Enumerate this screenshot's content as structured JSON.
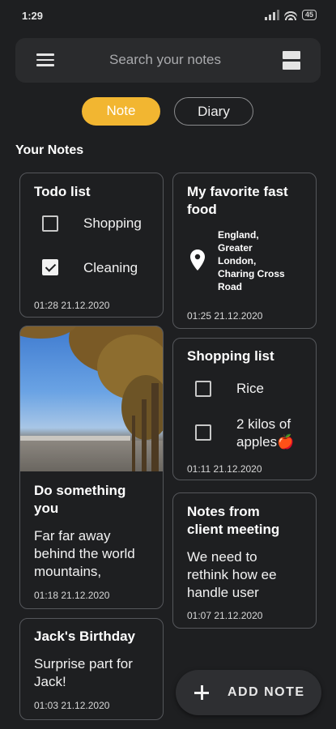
{
  "status_bar": {
    "time": "1:29",
    "battery": "45"
  },
  "search": {
    "placeholder": "Search your notes"
  },
  "tabs": {
    "note": "Note",
    "diary": "Diary",
    "active": "note",
    "active_color": "#f2b631"
  },
  "section_title": "Your Notes",
  "notes": {
    "todo": {
      "title": "Todo list",
      "items": [
        {
          "label": "Shopping",
          "checked": false
        },
        {
          "label": "Cleaning",
          "checked": true
        }
      ],
      "date": "01:28 21.12.2020"
    },
    "fastfood": {
      "title_line1": "My favorite fast",
      "title_line2": "food",
      "location": [
        "England,",
        "Greater",
        "London,",
        "Charing Cross",
        "Road"
      ],
      "date": "01:25 21.12.2020"
    },
    "something": {
      "title_line1": "Do something",
      "title_line2": "you",
      "body": [
        "Far far away",
        "behind the world",
        "mountains,"
      ],
      "date": "01:18 21.12.2020"
    },
    "shopping": {
      "title": "Shopping list",
      "items": [
        {
          "label": "Rice",
          "checked": false
        },
        {
          "label_line1": "2 kilos of",
          "label_line2": "apples🍎",
          "checked": false
        }
      ],
      "date": "01:11 21.12.2020"
    },
    "client": {
      "title_line1": "Notes from",
      "title_line2": "client meeting",
      "body": [
        "We need to",
        "rethink how ee",
        "handle user"
      ],
      "date": "01:07 21.12.2020"
    },
    "birthday": {
      "title": "Jack's Birthday",
      "body": [
        "Surprise part for",
        "Jack!"
      ],
      "date": "01:03 21.12.2020"
    }
  },
  "fab": {
    "label": "ADD NOTE"
  }
}
